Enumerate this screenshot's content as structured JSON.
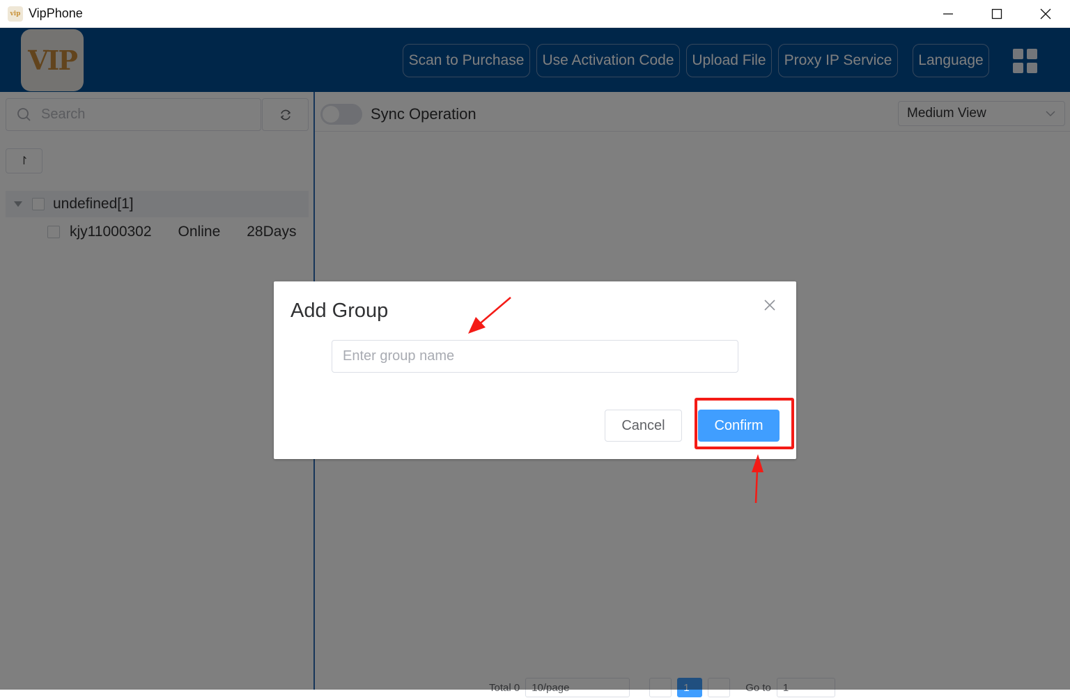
{
  "window": {
    "title": "VipPhone",
    "app_icon_text": "vip"
  },
  "header": {
    "logo_text": "VIP",
    "buttons": [
      {
        "label": "Scan to Purchase"
      },
      {
        "label": "Use Activation Code"
      },
      {
        "label": "Upload File"
      },
      {
        "label": "Proxy IP Service"
      },
      {
        "label": "Language"
      }
    ],
    "menu_icon": "grid-icon"
  },
  "sidebar": {
    "search_placeholder": "Search",
    "sort_label": "↾",
    "group": {
      "label": "undefined[1]"
    },
    "devices": [
      {
        "name": "kjy11000302",
        "status": "Online",
        "remaining": "28Days"
      }
    ]
  },
  "main": {
    "sync_label": "Sync Operation",
    "sync_enabled": false,
    "view_select": "Medium View",
    "pagination": {
      "total": "Total 0",
      "page_size": "10/page",
      "current_page": "1",
      "goto": "Go to",
      "goto_value": "1"
    }
  },
  "dialog": {
    "title": "Add Group",
    "input_placeholder": "Enter group name",
    "input_value": "",
    "cancel_label": "Cancel",
    "confirm_label": "Confirm"
  },
  "colors": {
    "header_bg": "#004d93",
    "primary": "#409eff",
    "annotation": "#f41b16"
  }
}
